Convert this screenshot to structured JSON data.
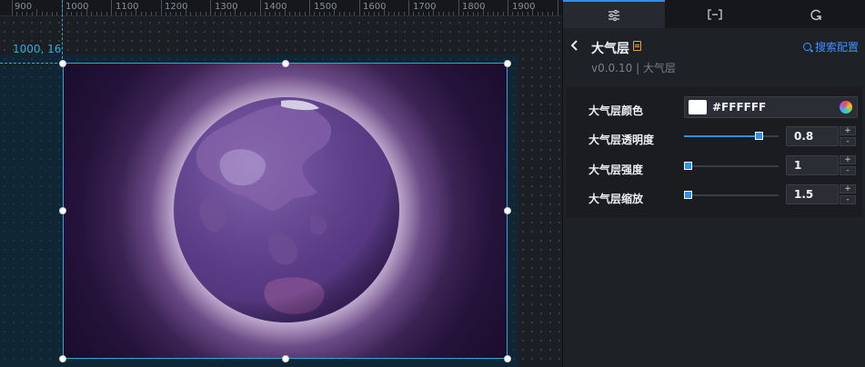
{
  "ruler": {
    "labels": [
      "900",
      "1000",
      "1100",
      "1200",
      "1300",
      "1400",
      "1500",
      "1600",
      "1700",
      "1800",
      "1900"
    ]
  },
  "canvas": {
    "coordinate": "1000, 16"
  },
  "tabs": [
    {
      "name": "settings-sliders-icon",
      "active": true
    },
    {
      "name": "bracket-icon",
      "active": false
    },
    {
      "name": "refresh-icon",
      "active": false
    }
  ],
  "header": {
    "title": "大气层",
    "version": "v0.0.10 | 大气层",
    "search_config": "搜索配置"
  },
  "props": {
    "color": {
      "label": "大气层颜色",
      "value": "#FFFFFF"
    },
    "opacity": {
      "label": "大气层透明度",
      "value": "0.8",
      "level": 0.8
    },
    "strength": {
      "label": "大气层强度",
      "value": "1",
      "level": 0
    },
    "scale": {
      "label": "大气层缩放",
      "value": "1.5",
      "level": 0
    }
  },
  "stepper": {
    "plus": "+",
    "minus": "-"
  }
}
